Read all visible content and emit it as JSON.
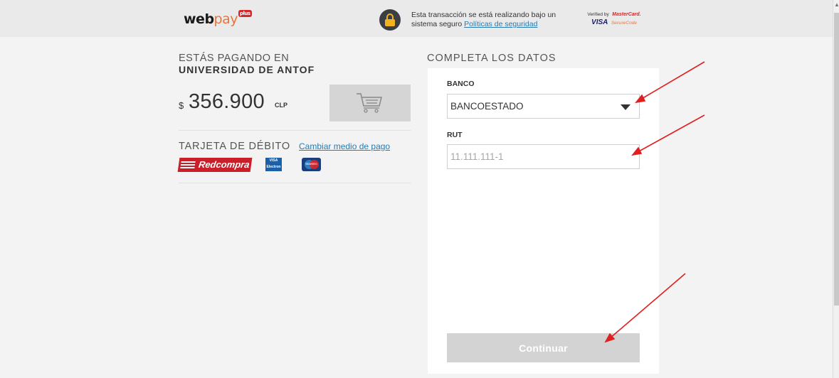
{
  "header": {
    "logo_web": "web",
    "logo_pay": "pay",
    "logo_plus": "plus",
    "secure_text": "Esta transacción se está realizando bajo un sistema seguro",
    "security_link": "Políticas de seguridad",
    "verified_by": "Verified by",
    "mastercard": "MasterCard.",
    "visa": "VISA",
    "securecode": "SecureCode"
  },
  "payment": {
    "paying_label": "ESTÁS PAGANDO EN",
    "merchant": "UNIVERSIDAD DE ANTOF",
    "currency_symbol": "$",
    "amount": "356.900",
    "currency": "CLP",
    "card_type": "TARJETA DE DÉBITO",
    "change_link": "Cambiar medio de pago",
    "redcompra": "Redcompra",
    "visa_electron_1": "VISA",
    "visa_electron_2": "Electron",
    "maestro": "Maestro"
  },
  "form": {
    "title": "COMPLETA LOS DATOS",
    "bank_label": "BANCO",
    "bank_value": "BANCOESTADO",
    "rut_label": "RUT",
    "rut_placeholder": "11.111.111-1",
    "rut_value": "",
    "continue_label": "Continuar"
  },
  "colors": {
    "accent_link": "#2a7ab0",
    "annotation_arrow": "#e02020",
    "disabled_button": "#d3d3d3"
  }
}
